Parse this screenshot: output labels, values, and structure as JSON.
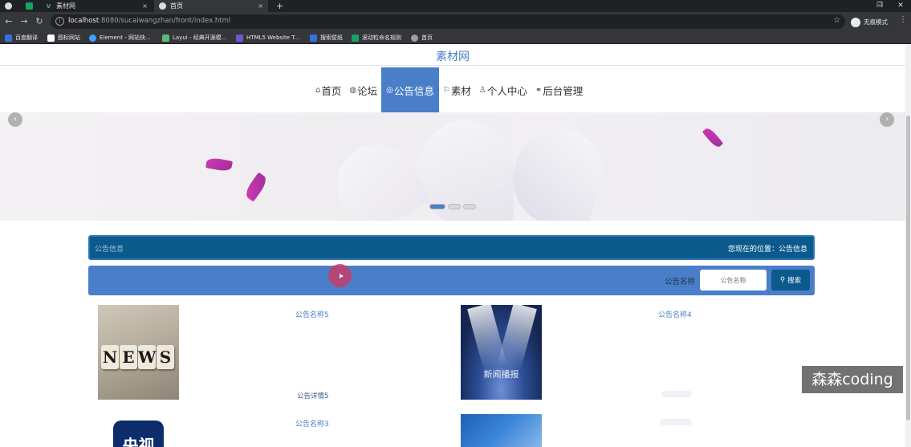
{
  "browser": {
    "tabs": [
      {
        "label": "",
        "icon": "globe-icon"
      },
      {
        "label": "",
        "icon": "app-icon"
      },
      {
        "label": "素材网",
        "icon": "vue-icon",
        "close": "×"
      },
      {
        "label": "首页",
        "icon": "globe-icon",
        "close": "×"
      }
    ],
    "new_tab": "+",
    "window_controls": {
      "minimize": "−",
      "restore": "❐",
      "close": "✕"
    },
    "url_host": "localhost",
    "url_rest": ":8080/sucaiwangzhan/front/index.html",
    "incognito_label": "无痕模式",
    "bookmarks": [
      {
        "label": "百度翻译",
        "color": "#3b6fe0"
      },
      {
        "label": "图标网站",
        "color": "#ffffff"
      },
      {
        "label": "Element - 网站快...",
        "color": "#409eff"
      },
      {
        "label": "Layui - 经典开源模...",
        "color": "#5fb878"
      },
      {
        "label": "HTML5 Website T...",
        "color": "#6a5acd"
      },
      {
        "label": "搜索壁纸",
        "color": "#3b6fe0"
      },
      {
        "label": "滚动粒命名规则",
        "color": "#1aa260"
      },
      {
        "label": "首页",
        "color": "#9aa0a6"
      }
    ]
  },
  "site": {
    "title": "素材网",
    "nav": [
      {
        "label": "首页",
        "icon": "home-icon",
        "glyph": "⌂",
        "active": false
      },
      {
        "label": "论坛",
        "icon": "forum-icon",
        "glyph": "◍",
        "active": false
      },
      {
        "label": "公告信息",
        "icon": "notice-icon",
        "glyph": "◎",
        "active": true
      },
      {
        "label": "素材",
        "icon": "flag-icon",
        "glyph": "⚐",
        "active": false
      },
      {
        "label": "个人中心",
        "icon": "user-icon",
        "glyph": "♙",
        "active": false
      },
      {
        "label": "后台管理",
        "icon": "link-icon",
        "glyph": "⚭",
        "active": false
      }
    ],
    "accent": "#4a7ec9",
    "dark_accent": "#0b5a8c"
  },
  "carousel": {
    "slides": 3,
    "active": 0,
    "prev": "‹",
    "next": "›"
  },
  "breadcrumb": {
    "section": "公告信息",
    "location": "您现在的位置：公告信息"
  },
  "search": {
    "label": "公告名称",
    "placeholder": "公告名称",
    "button": "搜索"
  },
  "notices": [
    {
      "title": "公告名称5",
      "detail": "公告详情5",
      "image": "news-image"
    },
    {
      "title": "公告名称4",
      "detail": "",
      "image": "stage-image",
      "image_text": "新闻播报"
    },
    {
      "title": "公告名称3",
      "detail": "",
      "image": "cctv-image",
      "image_text": "央视"
    },
    {
      "title": "",
      "detail": "",
      "image": "blue-image"
    }
  ],
  "news_letters": [
    "N",
    "E",
    "W",
    "S"
  ],
  "watermark": "森森coding"
}
